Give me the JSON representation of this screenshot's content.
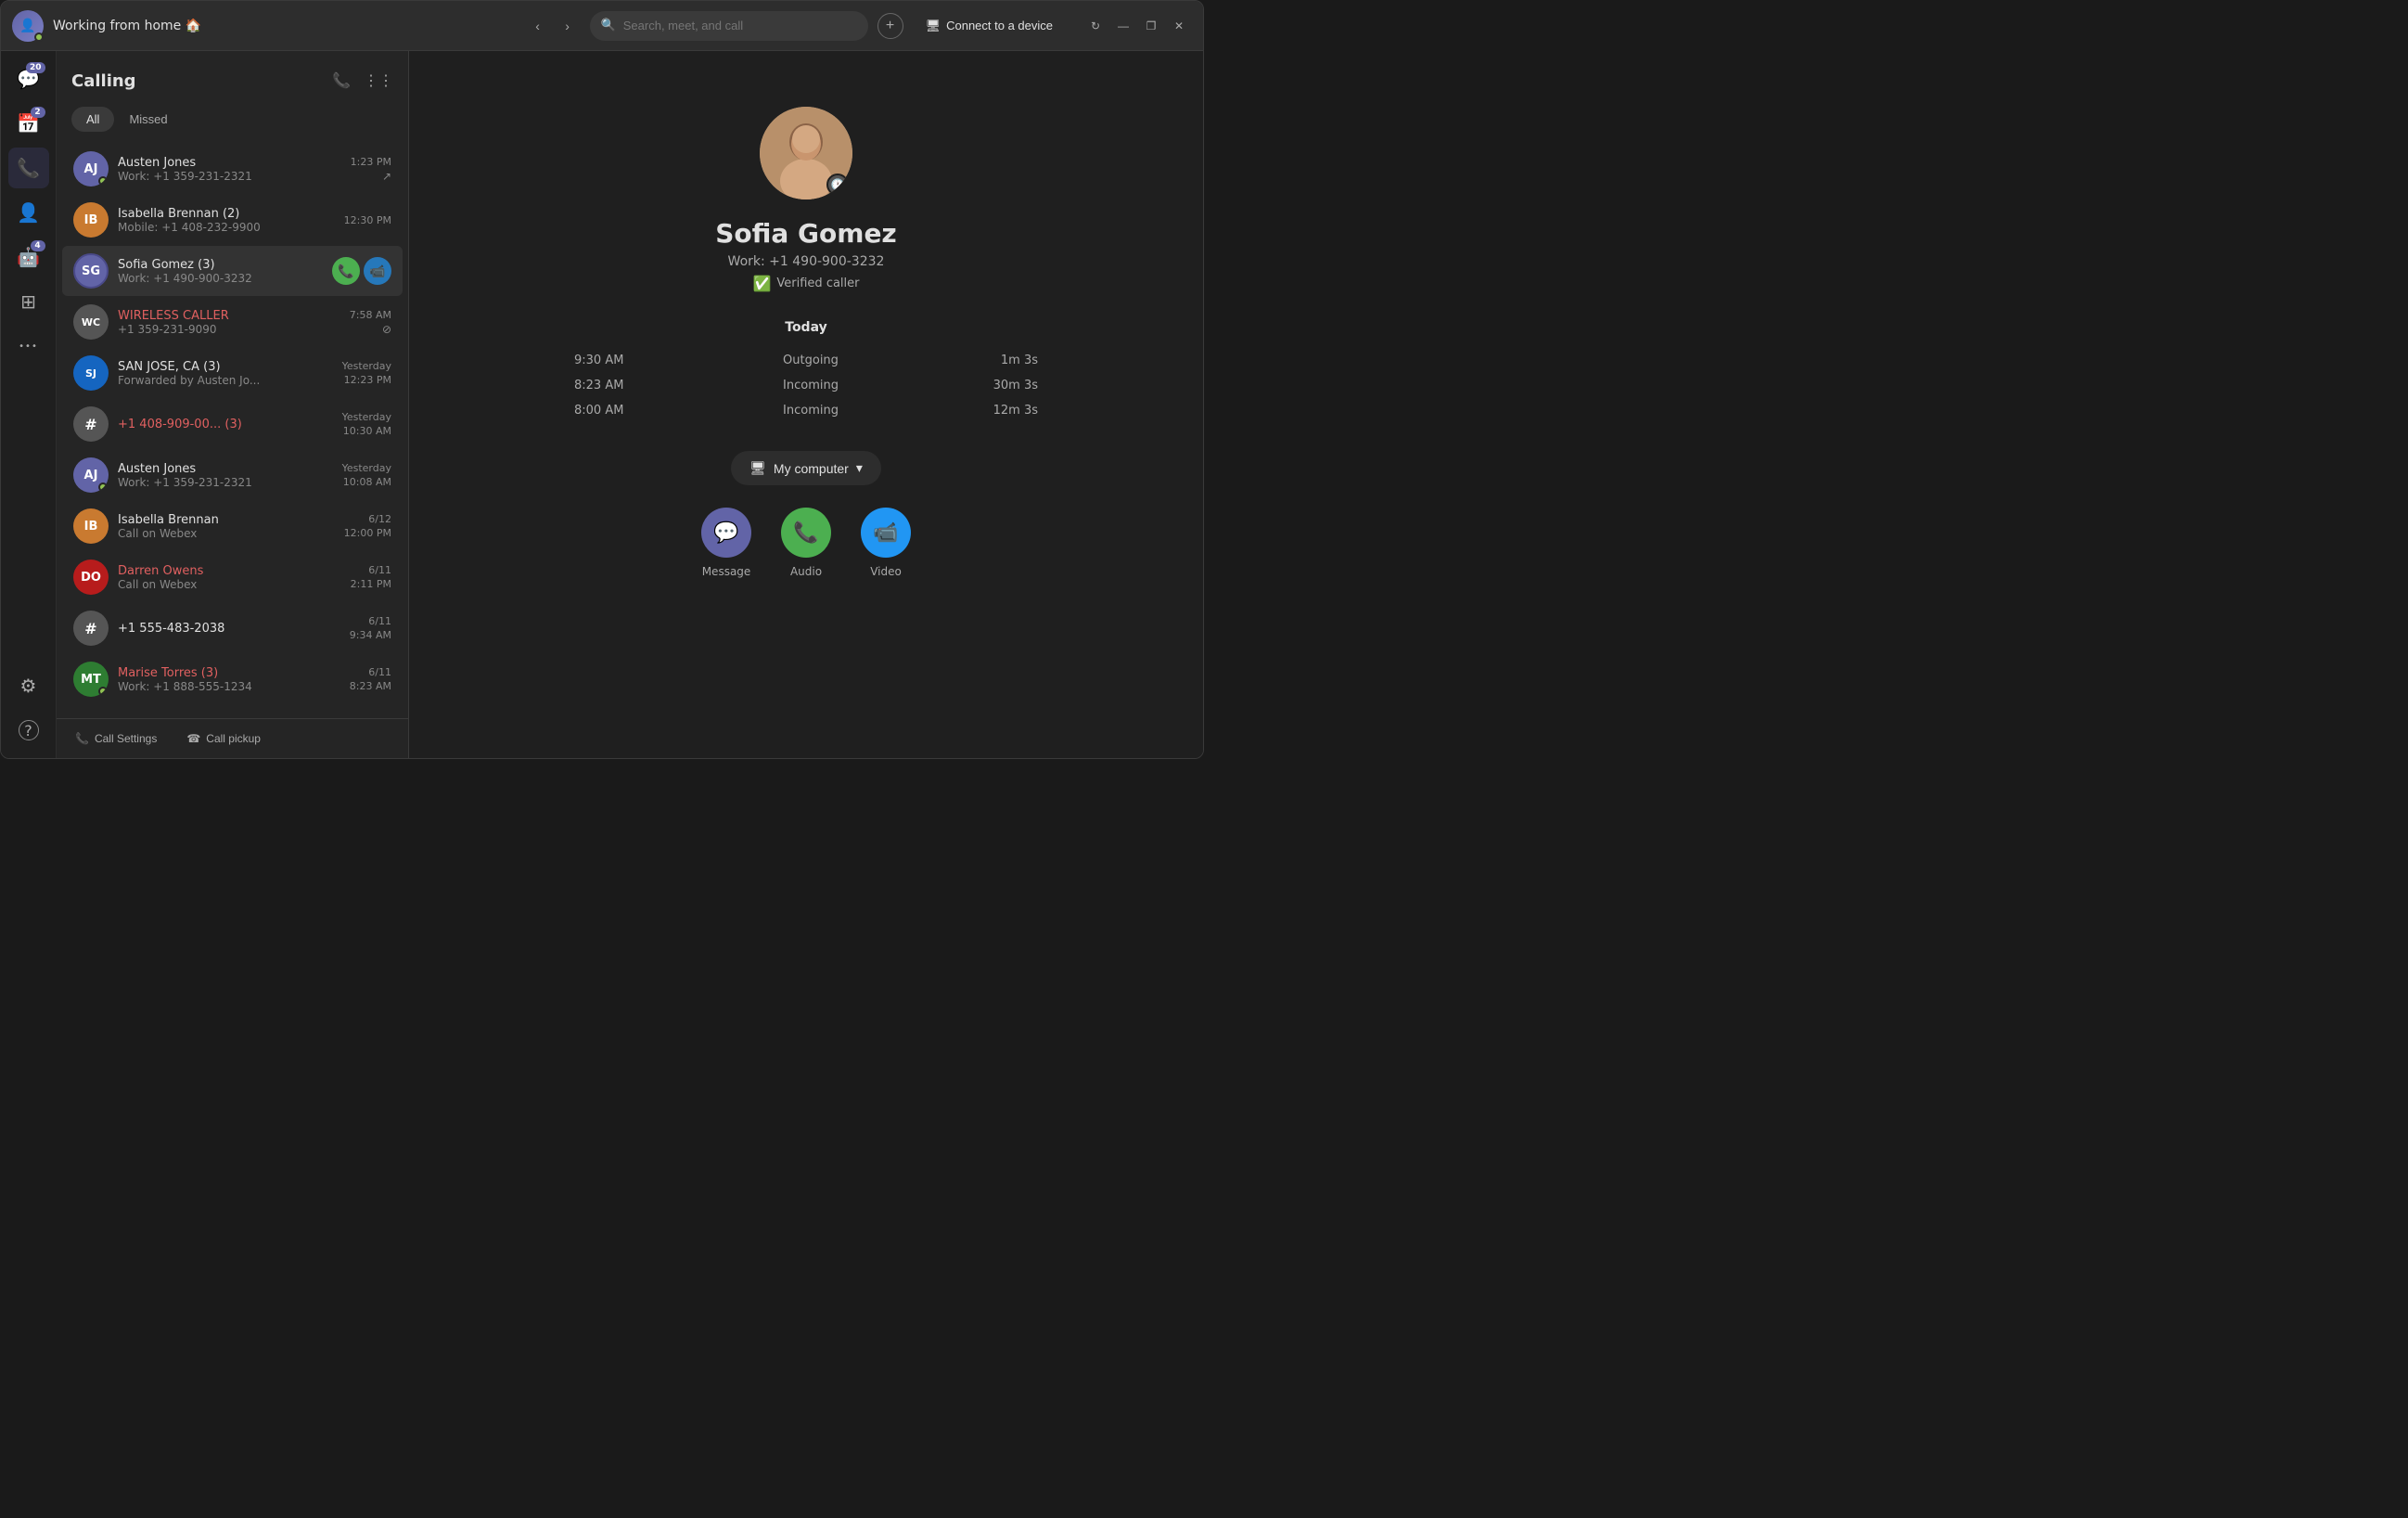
{
  "titleBar": {
    "appName": "Working from home 🏠",
    "searchPlaceholder": "Search, meet, and call",
    "connectBtn": "Connect to a device",
    "navBack": "‹",
    "navForward": "›",
    "winMin": "—",
    "winRestore": "❐",
    "winClose": "✕"
  },
  "sidebarNav": {
    "items": [
      {
        "name": "chat",
        "icon": "💬",
        "badge": "20",
        "active": false
      },
      {
        "name": "calendar",
        "icon": "📅",
        "badge": "2",
        "active": false
      },
      {
        "name": "calls",
        "icon": "📞",
        "badge": null,
        "active": true
      },
      {
        "name": "contacts",
        "icon": "👤",
        "badge": null,
        "active": false
      },
      {
        "name": "bots",
        "icon": "🤖",
        "badge": "4",
        "active": false
      },
      {
        "name": "apps",
        "icon": "⊞",
        "badge": null,
        "active": false
      },
      {
        "name": "more",
        "icon": "•••",
        "badge": null,
        "active": false
      }
    ],
    "settings": {
      "icon": "⚙",
      "name": "settings"
    },
    "help": {
      "icon": "?",
      "name": "help"
    }
  },
  "callingPanel": {
    "title": "Calling",
    "filterAll": "All",
    "filterMissed": "Missed",
    "callSettings": "Call Settings",
    "callPickup": "Call pickup",
    "callList": [
      {
        "id": 1,
        "name": "Austen Jones",
        "number": "Work: +1 359-231-2321",
        "time": "1:23 PM",
        "timeSub": null,
        "missed": false,
        "avatarType": "img",
        "avatarColor": "av-purple",
        "avatarInitials": "AJ",
        "online": true,
        "showActions": false,
        "callIcon": "↗"
      },
      {
        "id": 2,
        "name": "Isabella Brennan (2)",
        "number": "Mobile: +1 408-232-9900",
        "time": "12:30 PM",
        "timeSub": null,
        "missed": false,
        "avatarType": "img",
        "avatarColor": "av-orange",
        "avatarInitials": "IB",
        "online": false,
        "showActions": false,
        "callIcon": null
      },
      {
        "id": 3,
        "name": "Sofia Gomez (3)",
        "number": "Work: +1 490-900-3232",
        "time": null,
        "timeSub": null,
        "missed": false,
        "avatarType": "img",
        "avatarColor": "av-purple",
        "avatarInitials": "SG",
        "online": false,
        "showActions": true,
        "callIcon": null,
        "active": true
      },
      {
        "id": 4,
        "name": "WIRELESS CALLER",
        "number": "+1 359-231-9090",
        "time": "7:58 AM",
        "timeSub": null,
        "missed": true,
        "avatarType": "initials",
        "avatarColor": "av-gray",
        "avatarInitials": "WC",
        "online": false,
        "showActions": false,
        "callIcon": "⊘"
      },
      {
        "id": 5,
        "name": "SAN JOSE, CA (3)",
        "number": "Forwarded by Austen Jo...",
        "time": "Yesterday",
        "timeSub": "12:23 PM",
        "missed": false,
        "avatarType": "initials",
        "avatarColor": "av-blue",
        "avatarInitials": "SJ",
        "online": false,
        "showActions": false,
        "callIcon": "↗"
      },
      {
        "id": 6,
        "name": "+1 408-909-00... (3)",
        "number": null,
        "time": "Yesterday",
        "timeSub": "10:30 AM",
        "missed": true,
        "avatarType": "initials",
        "avatarColor": "av-gray",
        "avatarInitials": "#",
        "online": false,
        "showActions": false,
        "callIcon": null
      },
      {
        "id": 7,
        "name": "Austen Jones",
        "number": "Work: +1 359-231-2321",
        "time": "Yesterday",
        "timeSub": "10:08 AM",
        "missed": false,
        "avatarType": "img",
        "avatarColor": "av-purple",
        "avatarInitials": "AJ",
        "online": true,
        "showActions": false,
        "callIcon": "↗"
      },
      {
        "id": 8,
        "name": "Isabella Brennan",
        "number": "Call on Webex",
        "time": "6/12",
        "timeSub": "12:00 PM",
        "missed": false,
        "avatarType": "img",
        "avatarColor": "av-orange",
        "avatarInitials": "IB",
        "online": false,
        "showActions": false,
        "callIcon": "↗"
      },
      {
        "id": 9,
        "name": "Darren Owens",
        "number": "Call on Webex",
        "time": "6/11",
        "timeSub": "2:11 PM",
        "missed": true,
        "avatarType": "img",
        "avatarColor": "av-red",
        "avatarInitials": "DO",
        "online": false,
        "showActions": false,
        "callIcon": null
      },
      {
        "id": 10,
        "name": "+1 555-483-2038",
        "number": null,
        "time": "6/11",
        "timeSub": "9:34 AM",
        "missed": false,
        "avatarType": "initials",
        "avatarColor": "av-gray",
        "avatarInitials": "#",
        "online": false,
        "showActions": false,
        "callIcon": null
      },
      {
        "id": 11,
        "name": "Marise Torres (3)",
        "number": "Work: +1 888-555-1234",
        "time": "6/11",
        "timeSub": "8:23 AM",
        "missed": true,
        "avatarType": "img",
        "avatarColor": "av-green",
        "avatarInitials": "MT",
        "online": true,
        "showActions": false,
        "callIcon": null
      }
    ]
  },
  "contactDetail": {
    "name": "Sofia Gomez",
    "number": "Work: +1 490-900-3232",
    "verified": "Verified caller",
    "historyLabel": "Today",
    "history": [
      {
        "time": "9:30 AM",
        "type": "Outgoing",
        "duration": "1m 3s"
      },
      {
        "time": "8:23 AM",
        "type": "Incoming",
        "duration": "30m 3s"
      },
      {
        "time": "8:00 AM",
        "type": "Incoming",
        "duration": "12m 3s"
      }
    ],
    "deviceBtn": "My computer",
    "actions": [
      {
        "name": "message",
        "label": "Message",
        "icon": "💬",
        "class": "message"
      },
      {
        "name": "audio",
        "label": "Audio",
        "icon": "📞",
        "class": "audio"
      },
      {
        "name": "video",
        "label": "Video",
        "icon": "📹",
        "class": "video"
      }
    ]
  }
}
